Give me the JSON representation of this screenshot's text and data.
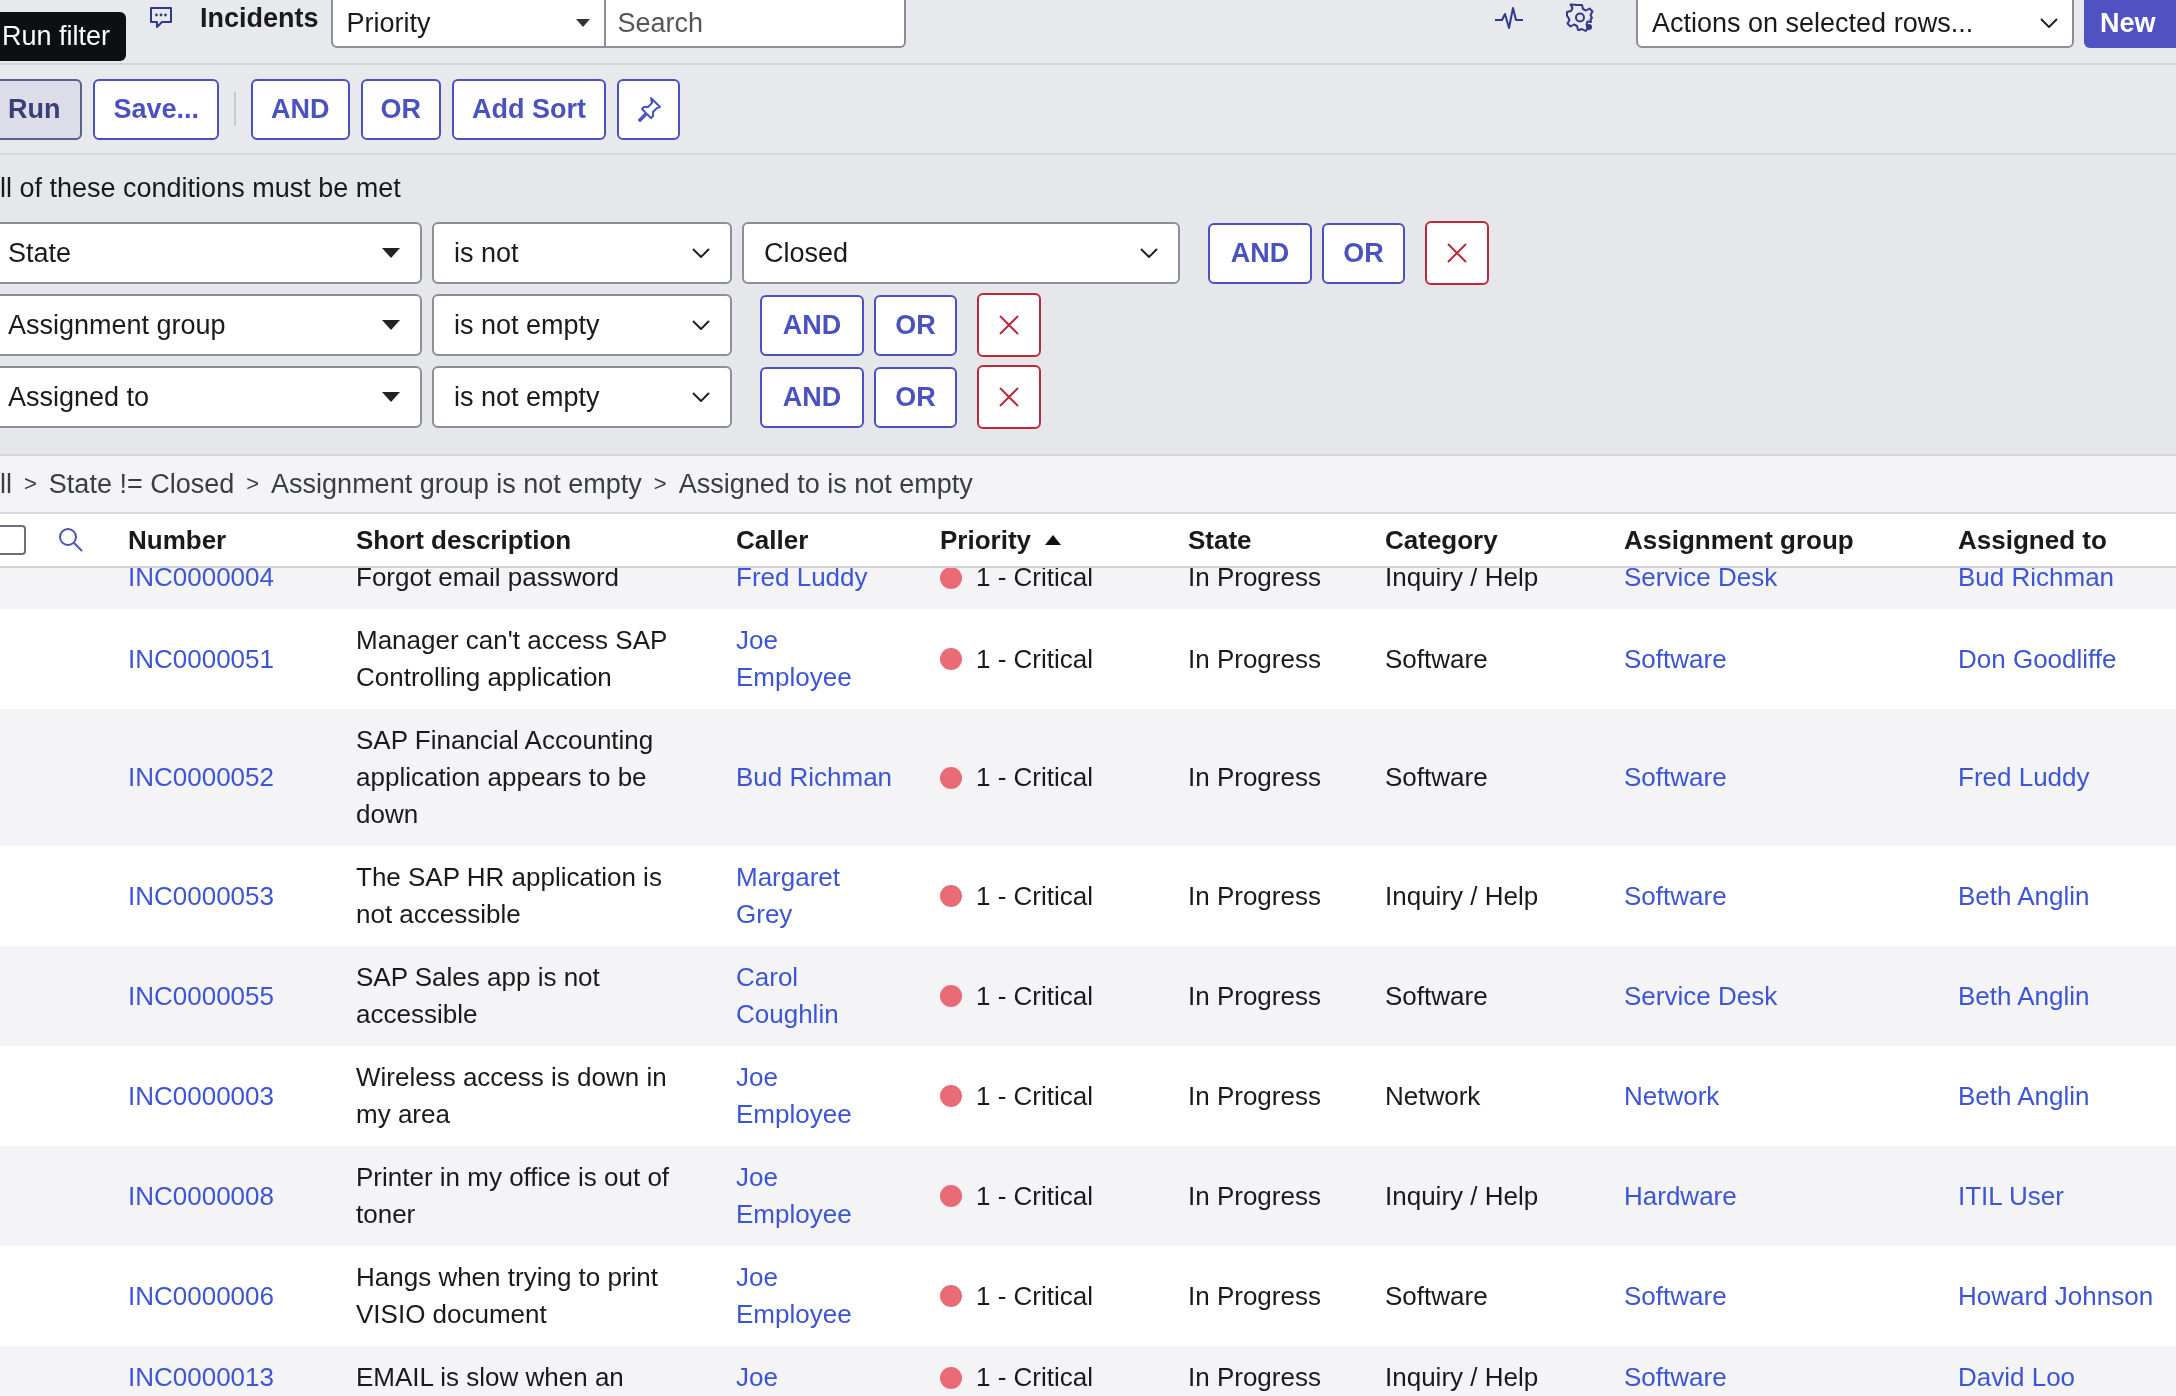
{
  "top_bar": {
    "title": "Incidents",
    "search_field": {
      "value": "Priority"
    },
    "search": {
      "placeholder": "Search"
    },
    "actions": {
      "value": "Actions on selected rows..."
    },
    "new_button": "New",
    "tooltip": "Run filter"
  },
  "toolbar": [
    {
      "label": "Run",
      "kind": "pressed"
    },
    {
      "label": "Save...",
      "kind": "outline"
    },
    {
      "kind": "divider"
    },
    {
      "label": "AND",
      "kind": "outline"
    },
    {
      "label": "OR",
      "kind": "outline"
    },
    {
      "label": "Add Sort",
      "kind": "outline"
    },
    {
      "kind": "pin"
    }
  ],
  "filter": {
    "heading": "ll of these conditions must be met",
    "conditions": [
      {
        "field": "State",
        "operator": "is not",
        "value": "Closed",
        "buttons": [
          "AND",
          "OR"
        ]
      },
      {
        "field": "Assignment group",
        "operator": "is not empty",
        "buttons": [
          "AND",
          "OR"
        ]
      },
      {
        "field": "Assigned to",
        "operator": "is not empty",
        "buttons": [
          "AND",
          "OR"
        ]
      }
    ]
  },
  "breadcrumb": {
    "separator": ">",
    "items": [
      "ll",
      "State != Closed",
      "Assignment group is not empty",
      "Assigned to is not empty"
    ]
  },
  "table": {
    "select_all": {
      "checked": false
    },
    "columns": [
      {
        "label": "Number",
        "sorted_ascending": false
      },
      {
        "label": "Short description",
        "sorted_ascending": false
      },
      {
        "label": "Caller",
        "sorted_ascending": false
      },
      {
        "label": "Priority",
        "sorted_ascending": true
      },
      {
        "label": "State",
        "sorted_ascending": false
      },
      {
        "label": "Category",
        "sorted_ascending": false
      },
      {
        "label": "Assignment group",
        "sorted_ascending": false
      },
      {
        "label": "Assigned to",
        "sorted_ascending": false
      }
    ],
    "rows": [
      {
        "number": "INC0000004",
        "short_description": "Forgot email password",
        "caller": "Fred Luddy",
        "priority": "1 - Critical",
        "state": "In Progress",
        "category": "Inquiry / Help",
        "assignment_group": "Service Desk",
        "assigned_to": "Bud Richman"
      },
      {
        "number": "INC0000051",
        "short_description": "Manager can't access SAP Controlling application",
        "caller": "Joe Employee",
        "priority": "1 - Critical",
        "state": "In Progress",
        "category": "Software",
        "assignment_group": "Software",
        "assigned_to": "Don Goodliffe"
      },
      {
        "number": "INC0000052",
        "short_description": "SAP Financial Accounting application appears to be down",
        "caller": "Bud Richman",
        "priority": "1 - Critical",
        "state": "In Progress",
        "category": "Software",
        "assignment_group": "Software",
        "assigned_to": "Fred Luddy"
      },
      {
        "number": "INC0000053",
        "short_description": "The SAP HR application is not accessible",
        "caller": "Margaret Grey",
        "priority": "1 - Critical",
        "state": "In Progress",
        "category": "Inquiry / Help",
        "assignment_group": "Software",
        "assigned_to": "Beth Anglin"
      },
      {
        "number": "INC0000055",
        "short_description": "SAP Sales app is not accessible",
        "caller": "Carol Coughlin",
        "priority": "1 - Critical",
        "state": "In Progress",
        "category": "Software",
        "assignment_group": "Service Desk",
        "assigned_to": "Beth Anglin"
      },
      {
        "number": "INC0000003",
        "short_description": "Wireless access is down in my area",
        "caller": "Joe Employee",
        "priority": "1 - Critical",
        "state": "In Progress",
        "category": "Network",
        "assignment_group": "Network",
        "assigned_to": "Beth Anglin"
      },
      {
        "number": "INC0000008",
        "short_description": "Printer in my office is out of toner",
        "caller": "Joe Employee",
        "priority": "1 - Critical",
        "state": "In Progress",
        "category": "Inquiry / Help",
        "assignment_group": "Hardware",
        "assigned_to": "ITIL User"
      },
      {
        "number": "INC0000006",
        "short_description": "Hangs when trying to print VISIO document",
        "caller": "Joe Employee",
        "priority": "1 - Critical",
        "state": "In Progress",
        "category": "Software",
        "assignment_group": "Software",
        "assigned_to": "Howard Johnson"
      },
      {
        "number": "INC0000013",
        "short_description": "EMAIL is slow when an",
        "caller": "Joe",
        "priority": "1 - Critical",
        "state": "In Progress",
        "category": "Inquiry / Help",
        "assignment_group": "Software",
        "assigned_to": "David Loo"
      }
    ]
  }
}
